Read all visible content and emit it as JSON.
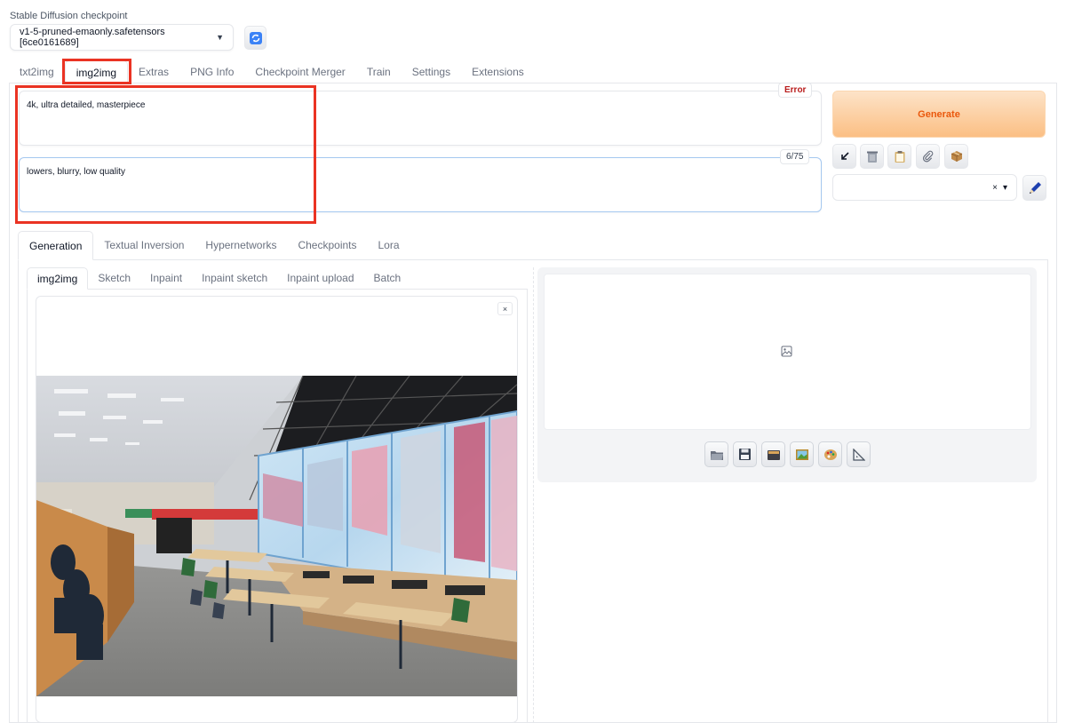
{
  "checkpoint": {
    "label": "Stable Diffusion checkpoint",
    "value": "v1-5-pruned-emaonly.safetensors [6ce0161689]"
  },
  "main_tabs": [
    {
      "label": "txt2img"
    },
    {
      "label": "img2img",
      "active": true
    },
    {
      "label": "Extras"
    },
    {
      "label": "PNG Info"
    },
    {
      "label": "Checkpoint Merger"
    },
    {
      "label": "Train"
    },
    {
      "label": "Settings"
    },
    {
      "label": "Extensions"
    }
  ],
  "prompt": {
    "positive": "4k, ultra detailed, masterpiece",
    "negative": "lowers, blurry, low quality",
    "error_badge": "Error",
    "token_count": "6/75"
  },
  "generate_label": "Generate",
  "tool_icons": [
    "arrow-icon",
    "trash-icon",
    "clipboard-icon",
    "paperclip-icon",
    "package-icon"
  ],
  "style_select": {
    "clear": "×",
    "caret": "▾"
  },
  "generation_tabs": [
    {
      "label": "Generation",
      "active": true
    },
    {
      "label": "Textual Inversion"
    },
    {
      "label": "Hypernetworks"
    },
    {
      "label": "Checkpoints"
    },
    {
      "label": "Lora"
    }
  ],
  "img2img_tabs": [
    {
      "label": "img2img",
      "active": true
    },
    {
      "label": "Sketch"
    },
    {
      "label": "Inpaint"
    },
    {
      "label": "Inpaint sketch"
    },
    {
      "label": "Inpaint upload"
    },
    {
      "label": "Batch"
    }
  ],
  "input_image": {
    "close": "×"
  },
  "output_buttons": [
    "folder-icon",
    "save-icon",
    "archive-icon",
    "image-icon",
    "palette-icon",
    "ruler-icon"
  ],
  "colors": {
    "accent": "#ea580c",
    "highlight": "#ea3323",
    "error": "#b91c1c"
  }
}
